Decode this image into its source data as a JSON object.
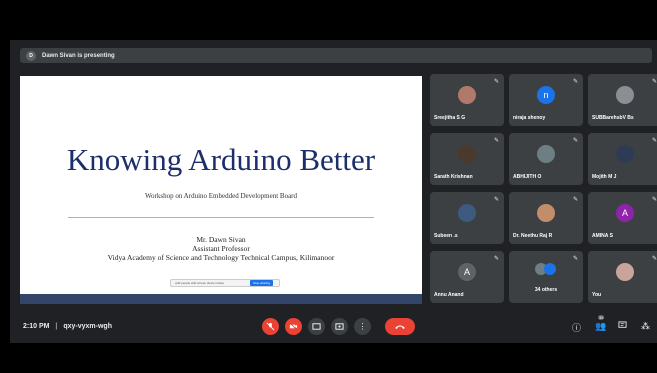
{
  "banner": {
    "initial": "D",
    "text": "Dawn Sivan is presenting"
  },
  "slide": {
    "title": "Knowing Arduino Better",
    "subtitle": "Workshop on Arduino Embedded Development Board",
    "presenter": "Mr. Dawn Sivan",
    "role": "Assistant Professor",
    "institution": "Vidya Academy of Science and Technology Technical Campus, Kilimanoor",
    "share_bar_text": "Add people with screen share invites",
    "share_bar_button": "Stop sharing"
  },
  "participants": [
    {
      "name": "Sreejitha S G",
      "type": "photo",
      "color": "#b07a6a"
    },
    {
      "name": "niraja shenoy",
      "type": "initial",
      "initial": "n",
      "color": "#1a73e8"
    },
    {
      "name": "SUBBarehsbV Bs",
      "type": "photo",
      "color": "#8a8f96"
    },
    {
      "name": "Sarath Krishnan",
      "type": "photo",
      "color": "#4a3a2e"
    },
    {
      "name": "ABHIJITH O",
      "type": "photo",
      "color": "#6d7f84"
    },
    {
      "name": "Mojith M J",
      "type": "photo",
      "color": "#2e3b55"
    },
    {
      "name": "Subeen .s",
      "type": "photo",
      "color": "#3d5a80"
    },
    {
      "name": "Dr. Neethu Raj R",
      "type": "photo",
      "color": "#c28e6a"
    },
    {
      "name": "AMINA S",
      "type": "initial",
      "initial": "A",
      "color": "#8e24aa"
    },
    {
      "name": "Annu Anand",
      "type": "initial",
      "initial": "A",
      "color": "#5f6368"
    },
    {
      "name": "34 others",
      "type": "group",
      "color": "#1a73e8"
    },
    {
      "name": "You",
      "type": "photo",
      "color": "#c9a49a"
    }
  ],
  "bottom": {
    "time": "2:10 PM",
    "separator": "|",
    "meeting_code": "qxy-vyxm-wgh",
    "people_count": "35"
  },
  "icons": {
    "mic_off": "mic-off-icon",
    "camera_off": "camera-off-icon",
    "captions": "captions-icon",
    "present": "present-screen-icon",
    "more": "more-options-icon",
    "leave": "leave-call-icon",
    "info": "info-icon",
    "people": "people-icon",
    "chat": "chat-icon",
    "activities": "activities-icon"
  }
}
